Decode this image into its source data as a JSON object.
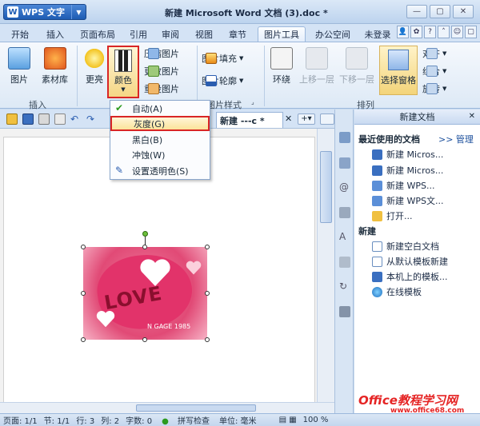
{
  "app": {
    "button_label": "WPS 文字",
    "logo": "W",
    "document_title": "新建 Microsoft Word 文档 (3).doc *"
  },
  "menu": {
    "tabs": [
      "开始",
      "插入",
      "页面布局",
      "引用",
      "审阅",
      "视图",
      "章节",
      "图片工具",
      "办公空间",
      "未登录"
    ]
  },
  "ribbon": {
    "picture": "图片",
    "material": "素材库",
    "brightness": "更亮",
    "color": "颜色",
    "compress": "压缩图片",
    "change": "更改图片",
    "reset": "重设图片",
    "fill": "图片填充",
    "outline": "图片轮廓",
    "wrap": "环绕",
    "bring_forward": "上移一层",
    "send_backward": "下移一层",
    "selection_pane": "选择窗格",
    "align": "对齐",
    "group": "组合",
    "rotate": "旋转",
    "group_insert": "插入",
    "group_style": "图片样式",
    "group_arrange": "排列"
  },
  "doctab": {
    "label": "新建 ---c *"
  },
  "color_menu": {
    "items": [
      {
        "label": "自动(A)",
        "checked": true
      },
      {
        "label": "灰度(G)",
        "highlighted": true
      },
      {
        "label": "黑白(B)"
      },
      {
        "label": "冲蚀(W)"
      },
      {
        "label": "设置透明色(S)"
      }
    ]
  },
  "image": {
    "text": "LOVE",
    "watermark": "N GAGE 1985"
  },
  "taskpane": {
    "title": "新建文档",
    "recent_heading": "最近使用的文档",
    "manage": ">> 管理",
    "recent": [
      "新建 Micros...",
      "新建 Micros...",
      "新建 WPS...",
      "新建 WPS文...",
      "打开..."
    ],
    "new_heading": "新建",
    "new_items": [
      "新建空白文档",
      "从默认模板新建",
      "本机上的模板...",
      "在线模板"
    ]
  },
  "status": {
    "page": "页面: 1/1",
    "section": "节: 1/1",
    "line": "行: 3",
    "col": "列: 2",
    "words": "字数: 0",
    "spell": "拼写检查",
    "unit": "单位: 毫米",
    "zoom": "100 %"
  },
  "site_watermark": {
    "title": "Office教程学习网",
    "url": "www.office68.com"
  },
  "colors": {
    "accent": "#d92525",
    "ribbon_bg": "#dde9f6",
    "title_bg": "#bcd3ee"
  }
}
